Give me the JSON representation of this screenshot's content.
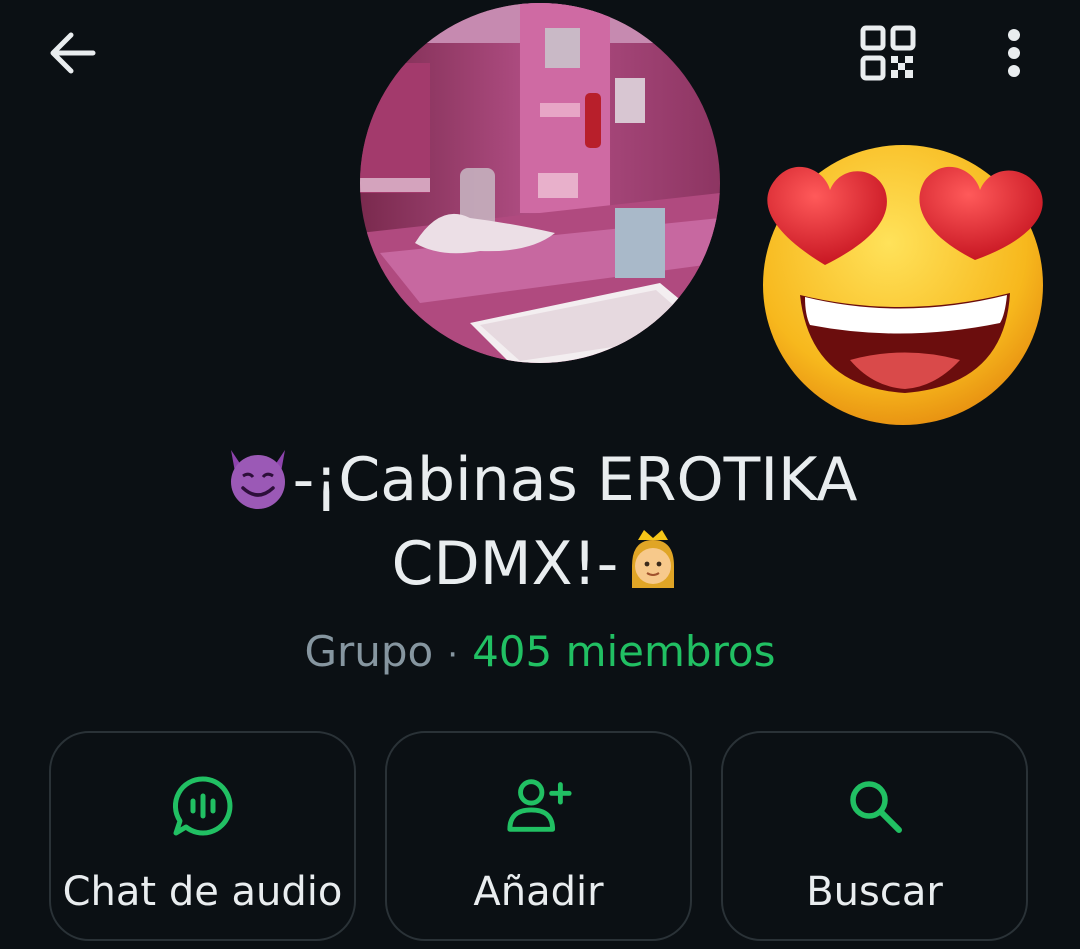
{
  "header": {
    "back_icon": "arrow-left-icon",
    "qr_icon": "qr-code-icon",
    "more_icon": "more-vertical-icon"
  },
  "profile": {
    "avatar_description": "group photo",
    "sticker_icon": "heart-eyes-emoji",
    "title_prefix_emoji": "smiling-devil-emoji",
    "title_line1": "-¡Cabinas EROTIKA",
    "title_line2": "CDMX!-",
    "title_suffix_emoji": "princess-emoji",
    "kind": "Grupo",
    "separator": "·",
    "members": "405 miembros"
  },
  "actions": [
    {
      "label": "Chat de audio",
      "icon": "audio-chat-icon"
    },
    {
      "label": "Añadir",
      "icon": "add-person-icon"
    },
    {
      "label": "Buscar",
      "icon": "search-icon"
    }
  ],
  "colors": {
    "background": "#0b1014",
    "accent": "#21c063",
    "muted": "#8696a0",
    "card_border": "#2a3237"
  }
}
